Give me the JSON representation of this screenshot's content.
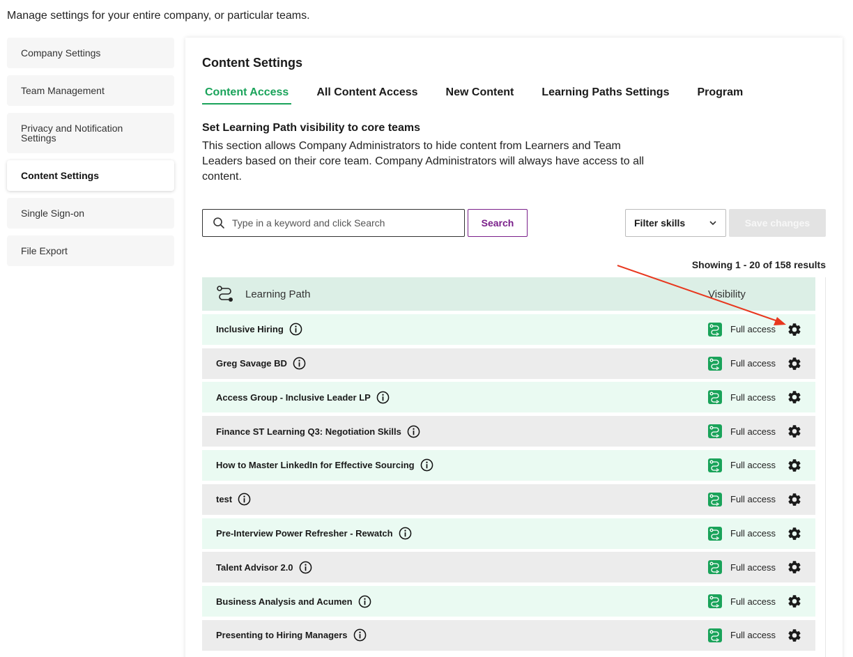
{
  "intro": "Manage settings for your entire company, or particular teams.",
  "sidebar": {
    "items": [
      {
        "label": "Company Settings"
      },
      {
        "label": "Team Management"
      },
      {
        "label": "Privacy and Notification Settings"
      },
      {
        "label": "Content Settings"
      },
      {
        "label": "Single Sign-on"
      },
      {
        "label": "File Export"
      }
    ],
    "active_index": 3
  },
  "panel": {
    "title": "Content Settings",
    "tabs": [
      {
        "label": "Content Access"
      },
      {
        "label": "All Content Access"
      },
      {
        "label": "New Content"
      },
      {
        "label": "Learning Paths Settings"
      },
      {
        "label": "Program"
      }
    ],
    "section_title": "Set Learning Path visibility to core teams",
    "section_desc": "This section allows Company Administrators to hide content from Learners and Team Leaders based on their core team. Company Administrators will always have access to all content.",
    "search": {
      "placeholder": "Type in a keyword and click Search",
      "button": "Search"
    },
    "filter_label": "Filter skills",
    "save_label": "Save changes",
    "showing": "Showing 1 - 20 of 158 results"
  },
  "table": {
    "head": {
      "learning_path": "Learning Path",
      "visibility": "Visibility"
    },
    "access_label": "Full access",
    "rows": [
      "Inclusive Hiring",
      "Greg Savage BD",
      "Access Group - Inclusive Leader LP",
      "Finance ST Learning Q3: Negotiation Skills",
      "How to Master LinkedIn for Effective Sourcing",
      "test",
      "Pre-Interview Power Refresher - Rewatch",
      "Talent Advisor 2.0",
      "Business Analysis and Acumen",
      "Presenting to Hiring Managers"
    ]
  },
  "colors": {
    "accent_green": "#1aa35a",
    "search_purple": "#7a1f8a",
    "annotation_arrow": "#e8371e"
  }
}
